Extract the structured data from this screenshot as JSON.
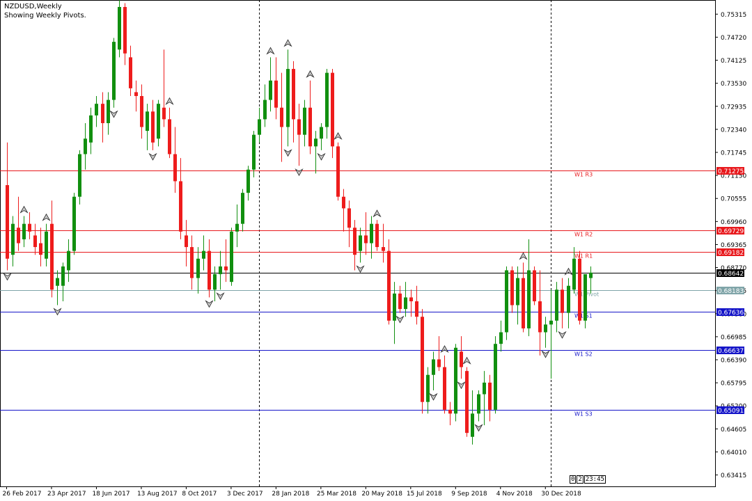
{
  "header": {
    "symbol_line": "NZDUSD,Weekly",
    "indicator_line": "Showing Weekly Pivots."
  },
  "timer": {
    "bars": "0",
    "bars2": "2",
    "clock": "23:45"
  },
  "colors": {
    "bull": "#118f0f",
    "bear": "#ee1c1c",
    "resistance": "#e8181c",
    "support": "#1414c8",
    "pivot": "#7fa4a8",
    "current": "#000000"
  },
  "chart_data": {
    "type": "candlestick",
    "symbol": "NZDUSD",
    "timeframe": "Weekly",
    "ylim": [
      0.6312,
      0.7568
    ],
    "y_ticks": [
      "0.75315",
      "0.74720",
      "0.74125",
      "0.73530",
      "0.72935",
      "0.72340",
      "0.71745",
      "0.71150",
      "0.70555",
      "0.69960",
      "0.69365",
      "0.68770",
      "0.68175",
      "0.67580",
      "0.66985",
      "0.66390",
      "0.65795",
      "0.65200",
      "0.64605",
      "0.64010",
      "0.63415"
    ],
    "x_labels": [
      {
        "label": "26 Feb 2017",
        "bar": 0
      },
      {
        "label": "23 Apr 2017",
        "bar": 8
      },
      {
        "label": "18 Jun 2017",
        "bar": 16
      },
      {
        "label": "13 Aug 2017",
        "bar": 24
      },
      {
        "label": "8 Oct 2017",
        "bar": 32
      },
      {
        "label": "3 Dec 2017",
        "bar": 40
      },
      {
        "label": "28 Jan 2018",
        "bar": 48
      },
      {
        "label": "25 Mar 2018",
        "bar": 56
      },
      {
        "label": "20 May 2018",
        "bar": 64
      },
      {
        "label": "15 Jul 2018",
        "bar": 72
      },
      {
        "label": "9 Sep 2018",
        "bar": 80
      },
      {
        "label": "4 Nov 2018",
        "bar": 88
      },
      {
        "label": "30 Dec 2018",
        "bar": 96
      }
    ],
    "separators": [
      {
        "bar": 45
      },
      {
        "bar": 97
      }
    ],
    "candles": [
      [
        0.709,
        0.72,
        0.687,
        0.69
      ],
      [
        0.691,
        0.701,
        0.688,
        0.699
      ],
      [
        0.698,
        0.706,
        0.692,
        0.694
      ],
      [
        0.695,
        0.701,
        0.693,
        0.699
      ],
      [
        0.699,
        0.702,
        0.695,
        0.697
      ],
      [
        0.696,
        0.699,
        0.691,
        0.693
      ],
      [
        0.694,
        0.698,
        0.688,
        0.691
      ],
      [
        0.69,
        0.699,
        0.688,
        0.697
      ],
      [
        0.699,
        0.705,
        0.68,
        0.682
      ],
      [
        0.683,
        0.687,
        0.678,
        0.685
      ],
      [
        0.683,
        0.689,
        0.679,
        0.688
      ],
      [
        0.687,
        0.695,
        0.684,
        0.692
      ],
      [
        0.692,
        0.707,
        0.691,
        0.706
      ],
      [
        0.706,
        0.718,
        0.704,
        0.717
      ],
      [
        0.717,
        0.725,
        0.713,
        0.721
      ],
      [
        0.72,
        0.729,
        0.717,
        0.727
      ],
      [
        0.727,
        0.732,
        0.724,
        0.73
      ],
      [
        0.73,
        0.733,
        0.72,
        0.725
      ],
      [
        0.725,
        0.733,
        0.722,
        0.731
      ],
      [
        0.731,
        0.747,
        0.729,
        0.746
      ],
      [
        0.744,
        0.757,
        0.742,
        0.755
      ],
      [
        0.755,
        0.756,
        0.74,
        0.743
      ],
      [
        0.742,
        0.745,
        0.732,
        0.734
      ],
      [
        0.733,
        0.736,
        0.728,
        0.732
      ],
      [
        0.732,
        0.735,
        0.721,
        0.724
      ],
      [
        0.723,
        0.73,
        0.718,
        0.728
      ],
      [
        0.728,
        0.731,
        0.718,
        0.72
      ],
      [
        0.721,
        0.731,
        0.719,
        0.73
      ],
      [
        0.729,
        0.744,
        0.724,
        0.726
      ],
      [
        0.726,
        0.729,
        0.716,
        0.717
      ],
      [
        0.717,
        0.724,
        0.707,
        0.71
      ],
      [
        0.71,
        0.716,
        0.695,
        0.697
      ],
      [
        0.696,
        0.7,
        0.688,
        0.693
      ],
      [
        0.693,
        0.696,
        0.682,
        0.685
      ],
      [
        0.685,
        0.693,
        0.681,
        0.69
      ],
      [
        0.69,
        0.696,
        0.687,
        0.692
      ],
      [
        0.692,
        0.695,
        0.68,
        0.682
      ],
      [
        0.682,
        0.688,
        0.679,
        0.686
      ],
      [
        0.686,
        0.692,
        0.682,
        0.688
      ],
      [
        0.688,
        0.695,
        0.684,
        0.687
      ],
      [
        0.684,
        0.698,
        0.683,
        0.697
      ],
      [
        0.697,
        0.704,
        0.693,
        0.699
      ],
      [
        0.699,
        0.708,
        0.697,
        0.707
      ],
      [
        0.707,
        0.714,
        0.705,
        0.713
      ],
      [
        0.713,
        0.723,
        0.711,
        0.722
      ],
      [
        0.722,
        0.729,
        0.72,
        0.726
      ],
      [
        0.726,
        0.735,
        0.724,
        0.731
      ],
      [
        0.731,
        0.742,
        0.728,
        0.736
      ],
      [
        0.736,
        0.742,
        0.726,
        0.729
      ],
      [
        0.729,
        0.738,
        0.715,
        0.724
      ],
      [
        0.724,
        0.744,
        0.719,
        0.739
      ],
      [
        0.739,
        0.741,
        0.72,
        0.726
      ],
      [
        0.726,
        0.73,
        0.714,
        0.722
      ],
      [
        0.722,
        0.731,
        0.719,
        0.729
      ],
      [
        0.729,
        0.736,
        0.717,
        0.719
      ],
      [
        0.719,
        0.723,
        0.712,
        0.721
      ],
      [
        0.721,
        0.725,
        0.718,
        0.724
      ],
      [
        0.724,
        0.739,
        0.721,
        0.738
      ],
      [
        0.738,
        0.739,
        0.716,
        0.719
      ],
      [
        0.719,
        0.72,
        0.705,
        0.706
      ],
      [
        0.706,
        0.708,
        0.697,
        0.703
      ],
      [
        0.703,
        0.705,
        0.693,
        0.698
      ],
      [
        0.698,
        0.7,
        0.687,
        0.691
      ],
      [
        0.692,
        0.698,
        0.689,
        0.696
      ],
      [
        0.696,
        0.702,
        0.691,
        0.694
      ],
      [
        0.694,
        0.701,
        0.69,
        0.699
      ],
      [
        0.699,
        0.7,
        0.692,
        0.693
      ],
      [
        0.693,
        0.699,
        0.689,
        0.692
      ],
      [
        0.692,
        0.695,
        0.673,
        0.674
      ],
      [
        0.674,
        0.684,
        0.668,
        0.681
      ],
      [
        0.681,
        0.683,
        0.676,
        0.677
      ],
      [
        0.677,
        0.684,
        0.675,
        0.68
      ],
      [
        0.68,
        0.682,
        0.675,
        0.679
      ],
      [
        0.679,
        0.683,
        0.673,
        0.675
      ],
      [
        0.675,
        0.677,
        0.65,
        0.653
      ],
      [
        0.653,
        0.662,
        0.65,
        0.66
      ],
      [
        0.66,
        0.666,
        0.656,
        0.664
      ],
      [
        0.664,
        0.67,
        0.661,
        0.662
      ],
      [
        0.662,
        0.665,
        0.65,
        0.651
      ],
      [
        0.651,
        0.653,
        0.647,
        0.65
      ],
      [
        0.65,
        0.668,
        0.648,
        0.667
      ],
      [
        0.666,
        0.67,
        0.659,
        0.662
      ],
      [
        0.661,
        0.662,
        0.644,
        0.645
      ],
      [
        0.644,
        0.656,
        0.642,
        0.65
      ],
      [
        0.65,
        0.656,
        0.648,
        0.655
      ],
      [
        0.655,
        0.661,
        0.647,
        0.658
      ],
      [
        0.658,
        0.66,
        0.648,
        0.651
      ],
      [
        0.651,
        0.67,
        0.65,
        0.668
      ],
      [
        0.668,
        0.674,
        0.666,
        0.671
      ],
      [
        0.671,
        0.688,
        0.669,
        0.687
      ],
      [
        0.687,
        0.688,
        0.676,
        0.678
      ],
      [
        0.678,
        0.688,
        0.673,
        0.685
      ],
      [
        0.685,
        0.689,
        0.671,
        0.672
      ],
      [
        0.672,
        0.695,
        0.67,
        0.687
      ],
      [
        0.687,
        0.688,
        0.678,
        0.679
      ],
      [
        0.679,
        0.687,
        0.665,
        0.671
      ],
      [
        0.671,
        0.675,
        0.667,
        0.673
      ],
      [
        0.673,
        0.682,
        0.659,
        0.674
      ],
      [
        0.674,
        0.684,
        0.671,
        0.682
      ],
      [
        0.682,
        0.685,
        0.672,
        0.676
      ],
      [
        0.676,
        0.685,
        0.672,
        0.683
      ],
      [
        0.682,
        0.693,
        0.681,
        0.69
      ],
      [
        0.69,
        0.692,
        0.673,
        0.674
      ],
      [
        0.674,
        0.685,
        0.672,
        0.686
      ],
      [
        0.685,
        0.688,
        0.681,
        0.6864
      ]
    ],
    "fractals_up": [
      3,
      7,
      21,
      29,
      47,
      50,
      54,
      59,
      66,
      78,
      82,
      92,
      100
    ],
    "fractals_down": [
      0,
      9,
      19,
      26,
      36,
      38,
      50,
      52,
      56,
      63,
      70,
      76,
      81,
      84,
      96,
      99
    ],
    "levels": [
      {
        "name": "W1 R3",
        "price": "0.71275",
        "value": 0.71275,
        "kind": "resistance"
      },
      {
        "name": "W1 R2",
        "price": "0.69729",
        "value": 0.69729,
        "kind": "resistance"
      },
      {
        "name": "W1 R1",
        "price": "0.69182",
        "value": 0.69182,
        "kind": "resistance"
      },
      {
        "name": "W1 Pivot",
        "price": "0.68183",
        "value": 0.68183,
        "kind": "pivot"
      },
      {
        "name": "W1 S1",
        "price": "0.67636",
        "value": 0.67636,
        "kind": "support"
      },
      {
        "name": "W1 S2",
        "price": "0.66637",
        "value": 0.66637,
        "kind": "support"
      },
      {
        "name": "W1 S3",
        "price": "0.65091",
        "value": 0.65091,
        "kind": "support"
      }
    ],
    "current_price": {
      "price": "0.68642",
      "value": 0.68642
    }
  }
}
